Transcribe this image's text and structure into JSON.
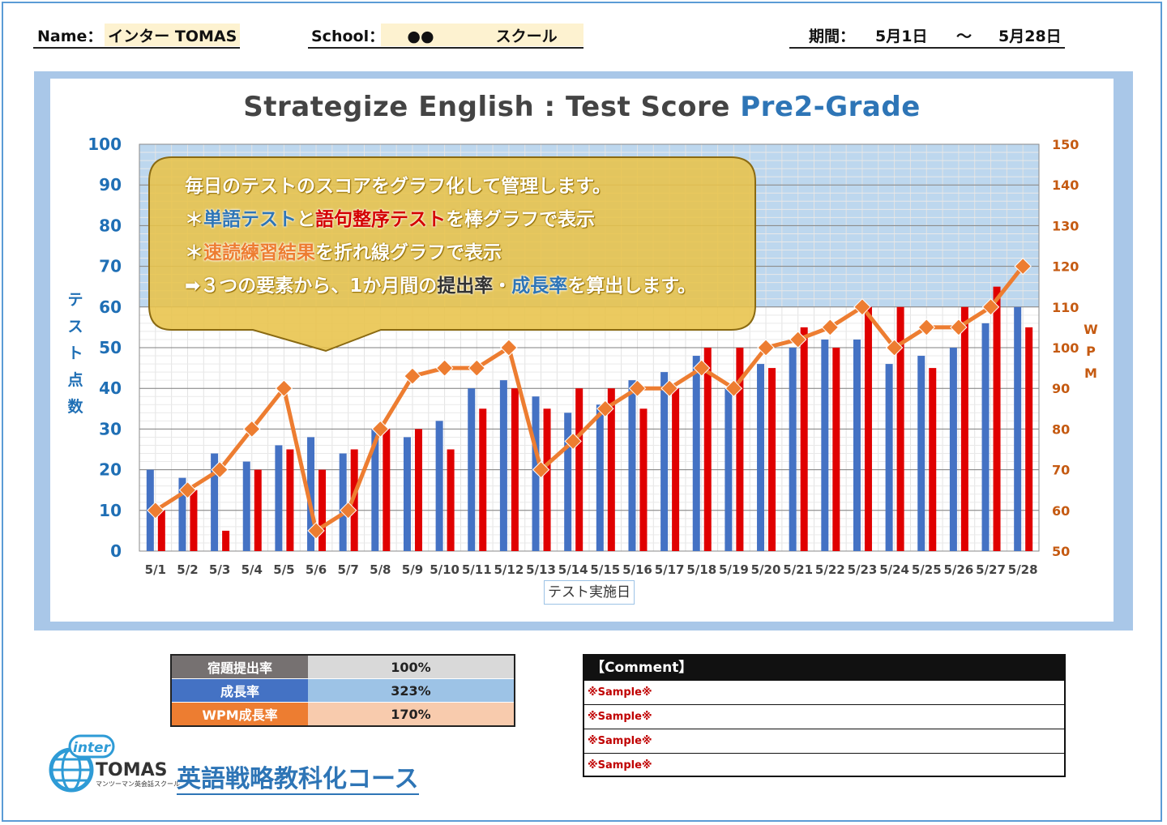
{
  "header": {
    "name_label": "Name：",
    "name_value": "インター TOMAS",
    "school_label": "School：",
    "school_value": "●●　　　　スクール",
    "period_label": "期間：",
    "period_start": "5月1日",
    "period_sep": "～",
    "period_end": "5月28日"
  },
  "chart": {
    "title_main": "Strategize English : Test  Score ",
    "title_sub": "Pre2-Grade",
    "ylabel_left": "テスト点数",
    "ylabel_right": "WPM",
    "xlabel": "テスト実施日"
  },
  "callout": {
    "line1": "毎日のテストのスコアをグラフ化して管理します。",
    "line2_prefix": "＊",
    "line2_blue": "単語テスト",
    "line2_mid": "と",
    "line2_red": "語句整序テスト",
    "line2_suffix": "を棒グラフで表示",
    "line3_prefix": "＊",
    "line3_orange": "速読練習結果",
    "line3_suffix": "を折れ線グラフで表示",
    "line4_prefix": "➡３つの要素から、1か月間の",
    "line4_dark": "提出率",
    "line4_dot": "・",
    "line4_blue": "成長率",
    "line4_suffix": "を算出します。"
  },
  "chart_data": {
    "type": "bar",
    "categories": [
      "5/1",
      "5/2",
      "5/3",
      "5/4",
      "5/5",
      "5/6",
      "5/7",
      "5/8",
      "5/9",
      "5/10",
      "5/11",
      "5/12",
      "5/13",
      "5/14",
      "5/15",
      "5/16",
      "5/17",
      "5/18",
      "5/19",
      "5/20",
      "5/21",
      "5/22",
      "5/23",
      "5/24",
      "5/25",
      "5/26",
      "5/27",
      "5/28"
    ],
    "series": [
      {
        "type": "bar",
        "axis": "left",
        "color": "#4472c4",
        "values": [
          20,
          18,
          24,
          22,
          26,
          28,
          24,
          30,
          28,
          32,
          40,
          42,
          38,
          34,
          36,
          42,
          44,
          48,
          40,
          46,
          50,
          52,
          52,
          46,
          48,
          50,
          56,
          60
        ]
      },
      {
        "type": "bar",
        "axis": "left",
        "color": "#e00000",
        "values": [
          10,
          15,
          5,
          20,
          25,
          20,
          25,
          30,
          30,
          25,
          35,
          40,
          35,
          40,
          40,
          35,
          40,
          50,
          50,
          45,
          55,
          50,
          60,
          60,
          45,
          60,
          65,
          55
        ]
      },
      {
        "type": "line",
        "axis": "right",
        "color": "#ed7d31",
        "values": [
          60,
          65,
          70,
          80,
          90,
          55,
          60,
          80,
          93,
          95,
          95,
          100,
          70,
          77,
          85,
          90,
          90,
          95,
          90,
          100,
          102,
          105,
          110,
          100,
          105,
          105,
          110,
          120
        ]
      }
    ],
    "ylim": [
      0,
      100
    ],
    "yticks": [
      0,
      10,
      20,
      30,
      40,
      50,
      60,
      70,
      80,
      90,
      100
    ],
    "y2lim": [
      50,
      150
    ],
    "y2ticks": [
      50,
      60,
      70,
      80,
      90,
      100,
      110,
      120,
      130,
      140,
      150
    ],
    "grid": true,
    "colors": {
      "left_axis": "#1f6fb5",
      "right_axis": "#c55a11",
      "bg": "#bdd7ee"
    }
  },
  "stats": [
    {
      "label": "宿題提出率",
      "value": "100%",
      "label_bg": "#767171",
      "value_bg": "#d9d9d9"
    },
    {
      "label": "成長率",
      "value": "323%",
      "label_bg": "#4472c4",
      "value_bg": "#9dc3e6"
    },
    {
      "label": "WPM成長率",
      "value": "170%",
      "label_bg": "#ed7d31",
      "value_bg": "#f8cbad"
    }
  ],
  "comment": {
    "title": "【Comment】",
    "rows": [
      "※Sample※",
      "※Sample※",
      "※Sample※",
      "※Sample※"
    ]
  },
  "logo": {
    "badge": "inter",
    "name": "TOMAS",
    "tagline": "マンツーマン英会話スクール"
  },
  "course_title": "英語戦略教科化コース"
}
